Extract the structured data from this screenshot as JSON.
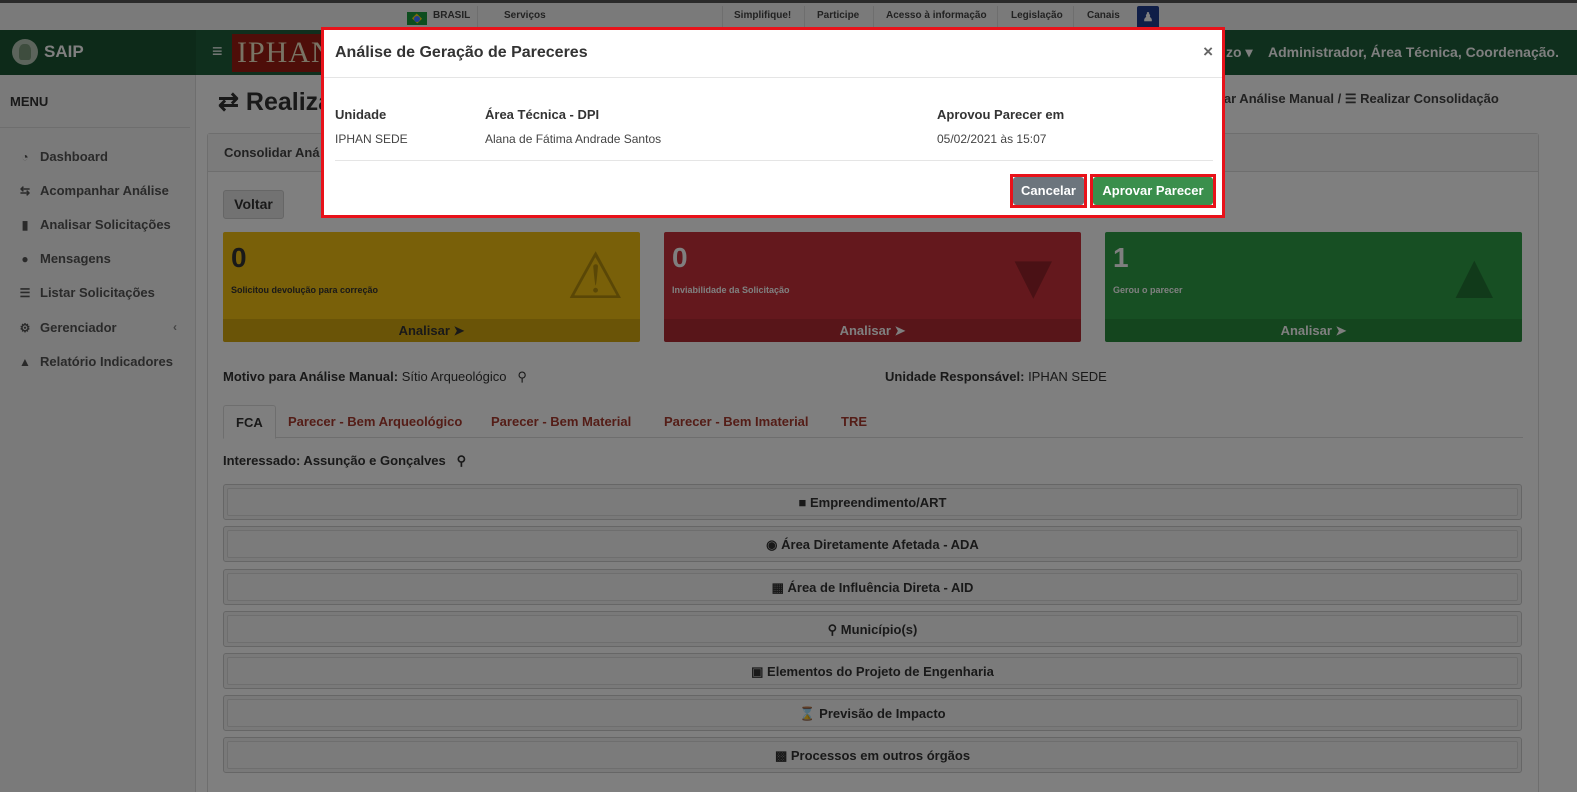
{
  "govbar": {
    "country": "BRASIL",
    "links": [
      "Serviços",
      "Simplifique!",
      "Participe",
      "Acesso à informação",
      "Legislação",
      "Canais"
    ]
  },
  "header": {
    "app_name": "SAIP",
    "logo_text": "IPHAN",
    "user_dropdown": "zo",
    "user_roles": "Administrador, Área Técnica, Coordenação..."
  },
  "sidebar": {
    "title": "MENU",
    "items": [
      {
        "label": "Dashboard",
        "icon": "dashboard-icon"
      },
      {
        "label": "Acompanhar Análise",
        "icon": "exchange-icon"
      },
      {
        "label": "Analisar Solicitações",
        "icon": "book-icon"
      },
      {
        "label": "Mensagens",
        "icon": "comments-icon"
      },
      {
        "label": "Listar Solicitações",
        "icon": "list-icon"
      },
      {
        "label": "Gerenciador",
        "icon": "cogs-icon"
      },
      {
        "label": "Relatório Indicadores",
        "icon": "area-chart-icon"
      }
    ]
  },
  "main": {
    "page_title": "Realiza",
    "breadcrumb": {
      "prev": "nhar Análise Manual",
      "separator": "/",
      "current": "Realizar Consolidação"
    },
    "card_title": "Consolidar Aná",
    "back_button": "Voltar",
    "boxes": [
      {
        "count": "0",
        "label": "Solicitou devolução para correção",
        "action": "Analisar",
        "color": "#f3c012",
        "icon": "warning-icon"
      },
      {
        "count": "0",
        "label": "Inviabilidade da Solicitação",
        "action": "Analisar",
        "color": "#c9303a",
        "icon": "thumbs-down-icon"
      },
      {
        "count": "1",
        "label": "Gerou o parecer",
        "action": "Analisar",
        "color": "#2e9e46",
        "icon": "thumbs-up-icon"
      }
    ],
    "motivo_label": "Motivo para Análise Manual:",
    "motivo_value": "Sítio Arqueológico",
    "unidade_label": "Unidade Responsável:",
    "unidade_value": "IPHAN SEDE",
    "tabs": [
      "FCA",
      "Parecer - Bem Arqueológico",
      "Parecer - Bem Material",
      "Parecer - Bem Imaterial",
      "TRE"
    ],
    "interessado": "Interessado: Assunção e Gonçalves",
    "sections": [
      {
        "label": "Empreendimento/ART",
        "icon": "building-icon"
      },
      {
        "label": "Área Diretamente Afetada - ADA",
        "icon": "globe-icon"
      },
      {
        "label": "Área de Influência Direta - AID",
        "icon": "map-icon"
      },
      {
        "label": "Município(s)",
        "icon": "map-marker-icon"
      },
      {
        "label": "Elementos do Projeto de Engenharia",
        "icon": "cubes-icon"
      },
      {
        "label": "Previsão de Impacto",
        "icon": "hourglass-icon"
      },
      {
        "label": "Processos em outros órgãos",
        "icon": "archive-icon"
      }
    ]
  },
  "modal": {
    "title": "Análise de Geração de Pareceres",
    "close": "×",
    "columns": [
      {
        "header": "Unidade",
        "value": "IPHAN SEDE"
      },
      {
        "header": "Área Técnica - DPI",
        "value": "Alana de Fátima Andrade Santos"
      },
      {
        "header": "Aprovou Parecer em",
        "value": "05/02/2021 às 15:07"
      }
    ],
    "cancel": "Cancelar",
    "approve": "Aprovar Parecer",
    "highlight_color": "#e8121a"
  }
}
